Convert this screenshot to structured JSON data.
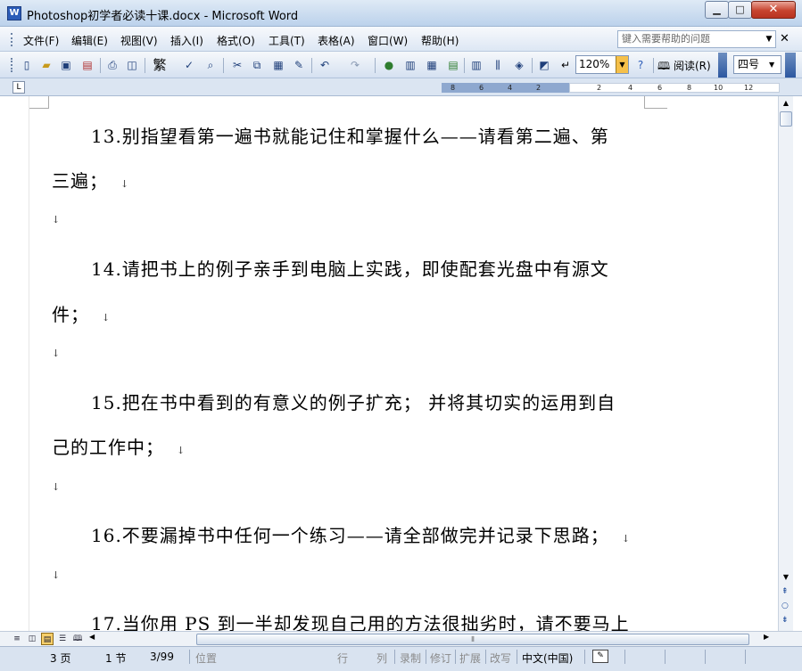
{
  "window": {
    "icon_label": "W",
    "title": "Photoshop初学者必读十课.docx - Microsoft Word",
    "minimize": "▁",
    "maximize": "□",
    "close": "✕"
  },
  "menu": {
    "items": [
      "文件(F)",
      "编辑(E)",
      "视图(V)",
      "插入(I)",
      "格式(O)",
      "工具(T)",
      "表格(A)",
      "窗口(W)",
      "帮助(H)"
    ],
    "help_placeholder": "键入需要帮助的问题",
    "dropdown_arrow": "▼",
    "doc_close": "✕"
  },
  "toolbar": {
    "traditional": "繁",
    "zoom": "120%",
    "zoom_arrow": "▼",
    "reading": "阅读(R)",
    "font_size": "四号",
    "font_size_arrow": "▼"
  },
  "ruler": {
    "tab_selector": "L",
    "left_ticks": [
      "8",
      "6",
      "4",
      "2"
    ],
    "right_ticks": [
      "2",
      "4",
      "6",
      "8",
      "10",
      "12"
    ]
  },
  "document": {
    "mark": "↓",
    "lines": [
      "13.别指望看第一遍书就能记住和掌握什么——请看第二遍、第",
      "三遍；",
      "14.请把书上的例子亲手到电脑上实践，即使配套光盘中有源文",
      "件；",
      "15.把在书中看到的有意义的例子扩充； 并将其切实的运用到自",
      "己的工作中；",
      "16.不要漏掉书中任何一个练习——请全部做完并记录下思路；",
      "17.当你用 PS 到一半却发现自己用的方法很拙劣时，请不要马上"
    ]
  },
  "scrollbar": {
    "up": "▲",
    "down": "▼",
    "prev_page": "⯭",
    "select_browse": "○",
    "next_page": "⯯"
  },
  "statusbar": {
    "page": "3 页",
    "section": "1 节",
    "page_of": "3/99",
    "position": "位置",
    "line": "行",
    "column": "列",
    "record": "录制",
    "revise": "修订",
    "extend": "扩展",
    "overtype": "改写",
    "language": "中文(中国)"
  }
}
